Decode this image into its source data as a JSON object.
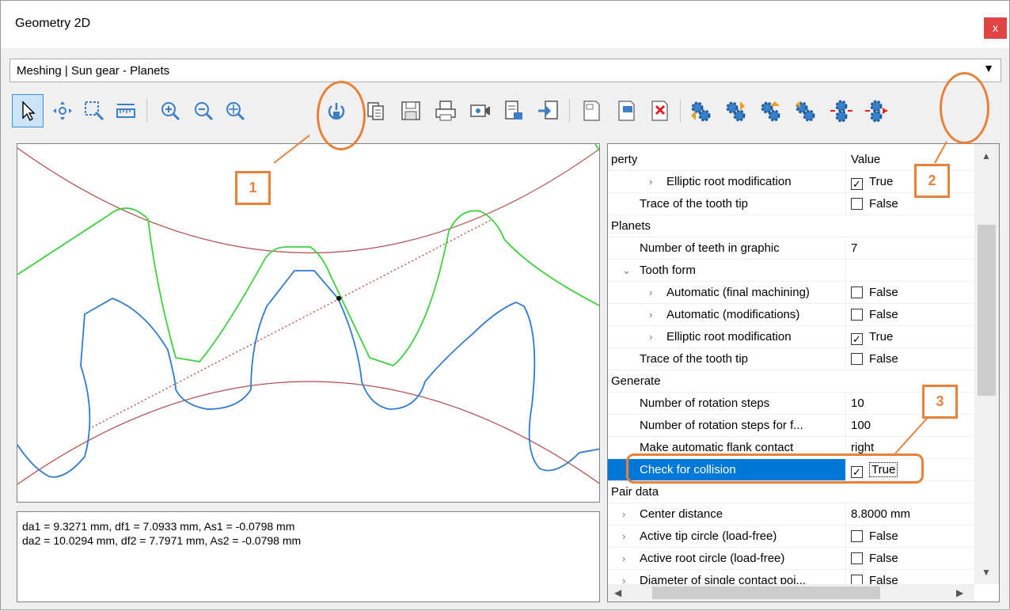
{
  "window": {
    "title": "Geometry 2D",
    "close_label": "x"
  },
  "combo": {
    "value": "Meshing | Sun gear - Planets"
  },
  "toolbar": {
    "icons": [
      "pointer-icon",
      "pan-icon",
      "zoom-window-icon",
      "measure-icon",
      "zoom-in-icon",
      "zoom-out-icon",
      "zoom-fit-icon",
      "animate-mesh-icon",
      "copy-icon",
      "save-icon",
      "print-icon",
      "record-video-icon",
      "export-icon",
      "import-icon",
      "properties-icon",
      "add-icon",
      "delete-icon",
      "gear-settings-1-icon",
      "gear-settings-2-icon",
      "gear-settings-3-icon",
      "gear-settings-4-icon",
      "gear-settings-5-icon",
      "gear-settings-6-icon"
    ]
  },
  "info": {
    "line1": "da1 = 9.3271 mm, df1 = 7.0933 mm, As1 = -0.0798 mm",
    "line2": "da2 = 10.0294 mm, df2 = 7.7971 mm, As2 = -0.0798 mm"
  },
  "grid": {
    "header": {
      "name": "perty",
      "value": "Value"
    },
    "rows": [
      {
        "name": "Elliptic root modification",
        "value": "True",
        "checkbox": true,
        "checked": true,
        "indent": 2,
        "chevron": ">"
      },
      {
        "name": "Trace of the tooth tip",
        "value": "False",
        "checkbox": true,
        "checked": false,
        "indent": 1
      },
      {
        "name": "Planets",
        "value": "",
        "category": true
      },
      {
        "name": "Number of teeth in graphic",
        "value": "7",
        "indent": 1
      },
      {
        "name": "Tooth form",
        "value": "",
        "indent": 1,
        "chevron": "v"
      },
      {
        "name": "Automatic (final machining)",
        "value": "False",
        "checkbox": true,
        "checked": false,
        "indent": 2,
        "chevron": ">"
      },
      {
        "name": "Automatic (modifications)",
        "value": "False",
        "checkbox": true,
        "checked": false,
        "indent": 2,
        "chevron": ">"
      },
      {
        "name": "Elliptic root modification",
        "value": "True",
        "checkbox": true,
        "checked": true,
        "indent": 2,
        "chevron": ">"
      },
      {
        "name": "Trace of the tooth tip",
        "value": "False",
        "checkbox": true,
        "checked": false,
        "indent": 1
      },
      {
        "name": "Generate",
        "value": "",
        "category": true
      },
      {
        "name": "Number of rotation steps",
        "value": "10",
        "indent": 1
      },
      {
        "name": "Number of rotation steps for f...",
        "value": "100",
        "indent": 1
      },
      {
        "name": "Make automatic flank contact",
        "value": "right",
        "indent": 1
      },
      {
        "name": "Check for collision",
        "value": "True",
        "checkbox": true,
        "checked": true,
        "indent": 1,
        "selected": true
      },
      {
        "name": "Pair data",
        "value": "",
        "category": true
      },
      {
        "name": "Center distance",
        "value": "8.8000 mm",
        "indent": 1,
        "chevron": ">"
      },
      {
        "name": "Active tip circle (load-free)",
        "value": "False",
        "checkbox": true,
        "checked": false,
        "indent": 1,
        "chevron": ">"
      },
      {
        "name": "Active root circle (load-free)",
        "value": "False",
        "checkbox": true,
        "checked": false,
        "indent": 1,
        "chevron": ">"
      },
      {
        "name": "Diameter of single contact poi...",
        "value": "False",
        "checkbox": true,
        "checked": false,
        "indent": 1,
        "chevron": ">"
      }
    ]
  },
  "callouts": [
    {
      "label": "1"
    },
    {
      "label": "2"
    },
    {
      "label": "3"
    }
  ],
  "colors": {
    "accent": "#e8823a",
    "selection": "#0078d7",
    "sun_gear": "#2e7bd0",
    "planet": "#3fd13f",
    "circle": "#b84a4a"
  }
}
